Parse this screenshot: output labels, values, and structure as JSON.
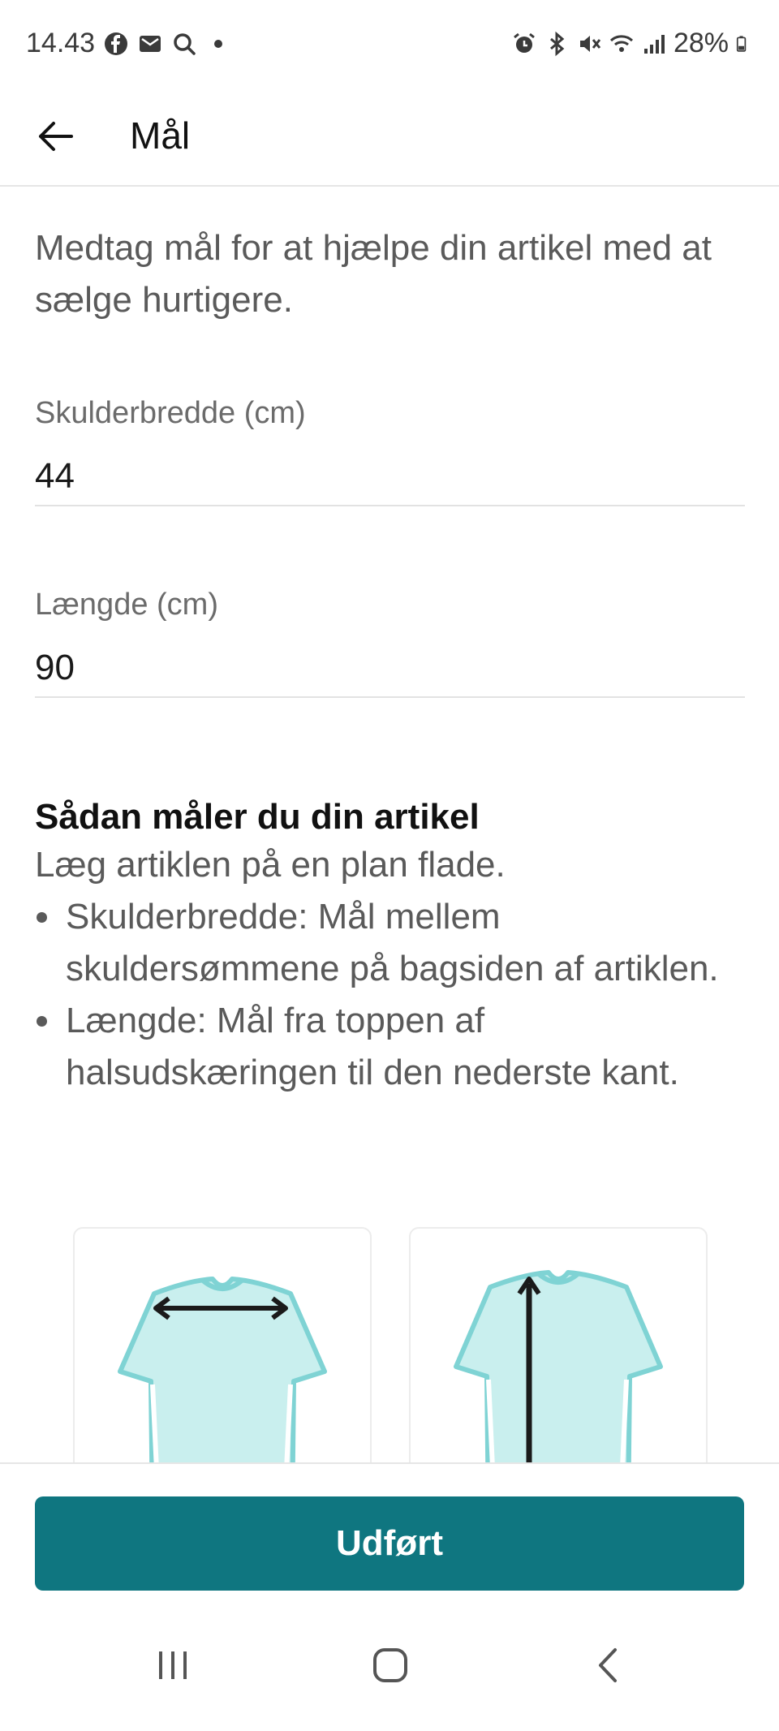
{
  "status_bar": {
    "time": "14.43",
    "notification_icons": [
      "facebook-icon",
      "mail-icon",
      "search-icon",
      "dot-icon"
    ],
    "system_icons": [
      "alarm-icon",
      "bluetooth-icon",
      "mute-icon",
      "wifi-icon",
      "signal-icon",
      "battery-icon"
    ],
    "battery": "28%"
  },
  "app_bar": {
    "title": "Mål"
  },
  "intro": "Medtag mål for at hjælpe din artikel med at sælge hurtigere.",
  "fields": [
    {
      "label": "Skulderbredde (cm)",
      "value": "44"
    },
    {
      "label": "Længde (cm)",
      "value": "90"
    }
  ],
  "howto": {
    "title": "Sådan måler du din artikel",
    "text": "Læg artiklen på en plan flade.",
    "bullets": [
      "Skulderbredde: Mål mellem skuldersømmene på bagsiden af artiklen.",
      "Længde: Mål fra toppen af halsudskæringen til den nederste kant."
    ]
  },
  "illustrations": [
    "shoulder-width-illustration",
    "length-illustration"
  ],
  "colors": {
    "accent": "#0f7680",
    "shirt_fill": "#c9efee",
    "shirt_stroke": "#7fd3d4"
  },
  "done_button": {
    "label": "Udført"
  },
  "nav_bar": {
    "buttons": [
      "recent-apps-icon",
      "home-icon",
      "back-icon"
    ]
  }
}
